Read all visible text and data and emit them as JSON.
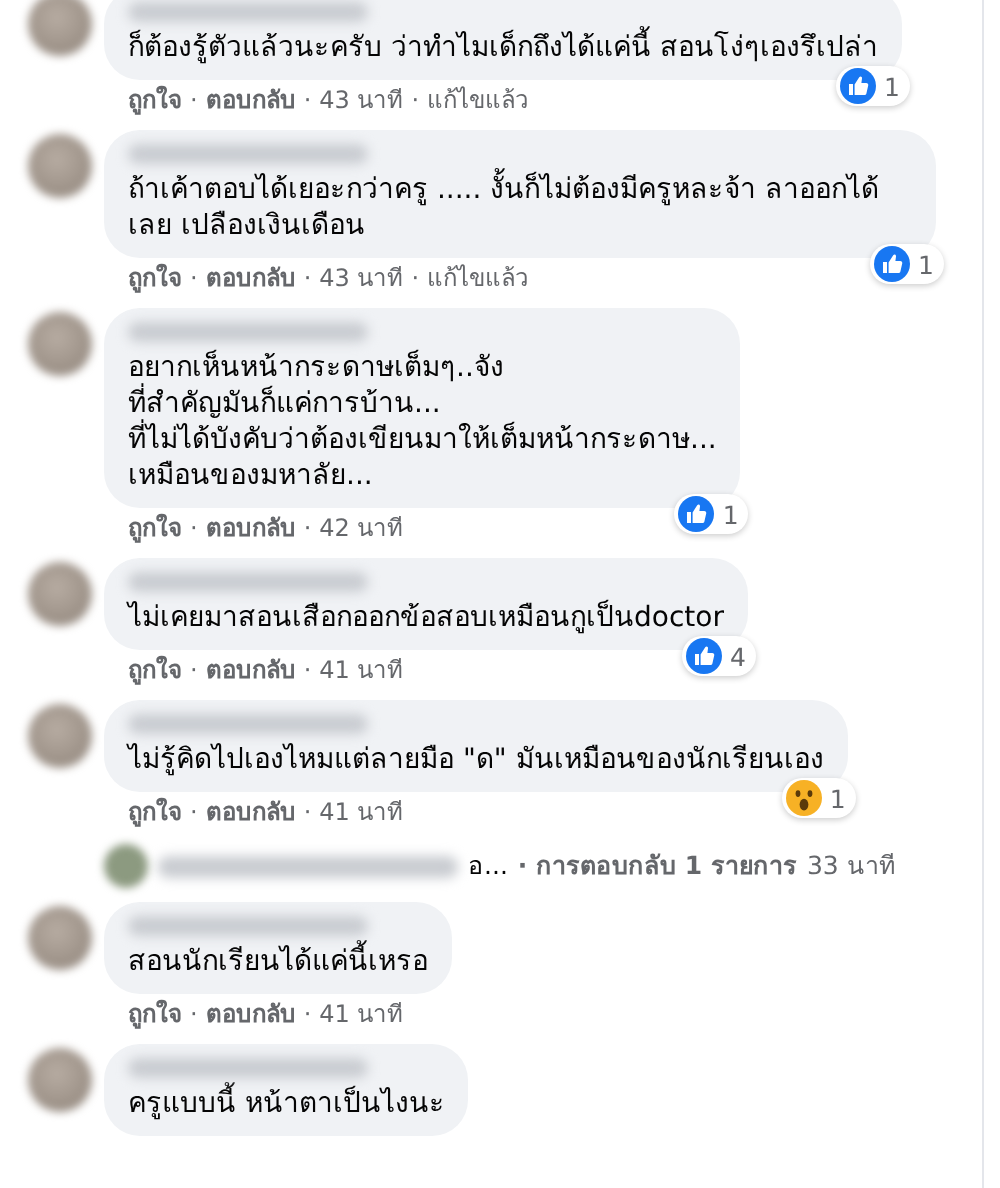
{
  "comments": [
    {
      "text": "ก็ต้องรู้ตัวแล้วนะครับ ว่าทำไมเด็กถึงได้แค่นี้ สอนโง่ๆเองรึเปล่า",
      "reaction": {
        "kind": "like",
        "count": "1"
      },
      "meta": [
        {
          "kind": "like",
          "text": "ถูกใจ"
        },
        {
          "kind": "dot",
          "text": "·"
        },
        {
          "kind": "reply",
          "text": "ตอบกลับ"
        },
        {
          "kind": "dot",
          "text": "·"
        },
        {
          "kind": "time",
          "text": "43 นาที"
        },
        {
          "kind": "dot",
          "text": "·"
        },
        {
          "kind": "edited",
          "text": "แก้ไขแล้ว"
        }
      ]
    },
    {
      "text": "ถ้าเค้าตอบได้เยอะกว่าครู ..... งั้นก็ไม่ต้องมีครูหละจ้า ลาออกได้ เลย เปลืองเงินเดือน",
      "reaction": {
        "kind": "like",
        "count": "1"
      },
      "meta": [
        {
          "kind": "like",
          "text": "ถูกใจ"
        },
        {
          "kind": "dot",
          "text": "·"
        },
        {
          "kind": "reply",
          "text": "ตอบกลับ"
        },
        {
          "kind": "dot",
          "text": "·"
        },
        {
          "kind": "time",
          "text": "43 นาที"
        },
        {
          "kind": "dot",
          "text": "·"
        },
        {
          "kind": "edited",
          "text": "แก้ไขแล้ว"
        }
      ]
    },
    {
      "text": "อยากเห็นหน้ากระดาษเต็มๆ..จัง\nที่สำคัญมันก็แค่การบ้าน...\nที่ไม่ได้บังคับว่าต้องเขียนมาให้เต็มหน้ากระดาษ...\nเหมือนของมหาลัย...",
      "reaction": {
        "kind": "like",
        "count": "1"
      },
      "meta": [
        {
          "kind": "like",
          "text": "ถูกใจ"
        },
        {
          "kind": "dot",
          "text": "·"
        },
        {
          "kind": "reply",
          "text": "ตอบกลับ"
        },
        {
          "kind": "dot",
          "text": "·"
        },
        {
          "kind": "time",
          "text": "42 นาที"
        }
      ]
    },
    {
      "text": "ไม่เคยมาสอนเสือกออกข้อสอบเหมือนกูเป็นdoctor",
      "reaction": {
        "kind": "like",
        "count": "4"
      },
      "meta": [
        {
          "kind": "like",
          "text": "ถูกใจ"
        },
        {
          "kind": "dot",
          "text": "·"
        },
        {
          "kind": "reply",
          "text": "ตอบกลับ"
        },
        {
          "kind": "dot",
          "text": "·"
        },
        {
          "kind": "time",
          "text": "41 นาที"
        }
      ]
    },
    {
      "text": "ไม่รู้คิดไปเองไหมแต่ลายมือ \"ด\" มันเหมือนของนักเรียนเอง",
      "reaction": {
        "kind": "wow",
        "count": "1"
      },
      "meta": [
        {
          "kind": "like",
          "text": "ถูกใจ"
        },
        {
          "kind": "dot",
          "text": "·"
        },
        {
          "kind": "reply",
          "text": "ตอบกลับ"
        },
        {
          "kind": "dot",
          "text": "·"
        },
        {
          "kind": "time",
          "text": "41 นาที"
        }
      ],
      "replies_summary": {
        "snippet": "อ...",
        "label": "· การตอบกลับ 1 รายการ",
        "time": "33 นาที"
      }
    },
    {
      "text": "สอนนักเรียนได้แค่นี้เหรอ",
      "meta": [
        {
          "kind": "like",
          "text": "ถูกใจ"
        },
        {
          "kind": "dot",
          "text": "·"
        },
        {
          "kind": "reply",
          "text": "ตอบกลับ"
        },
        {
          "kind": "dot",
          "text": "·"
        },
        {
          "kind": "time",
          "text": "41 นาที"
        }
      ]
    },
    {
      "text": "ครูแบบนี้ หน้าตาเป็นไงนะ"
    }
  ]
}
